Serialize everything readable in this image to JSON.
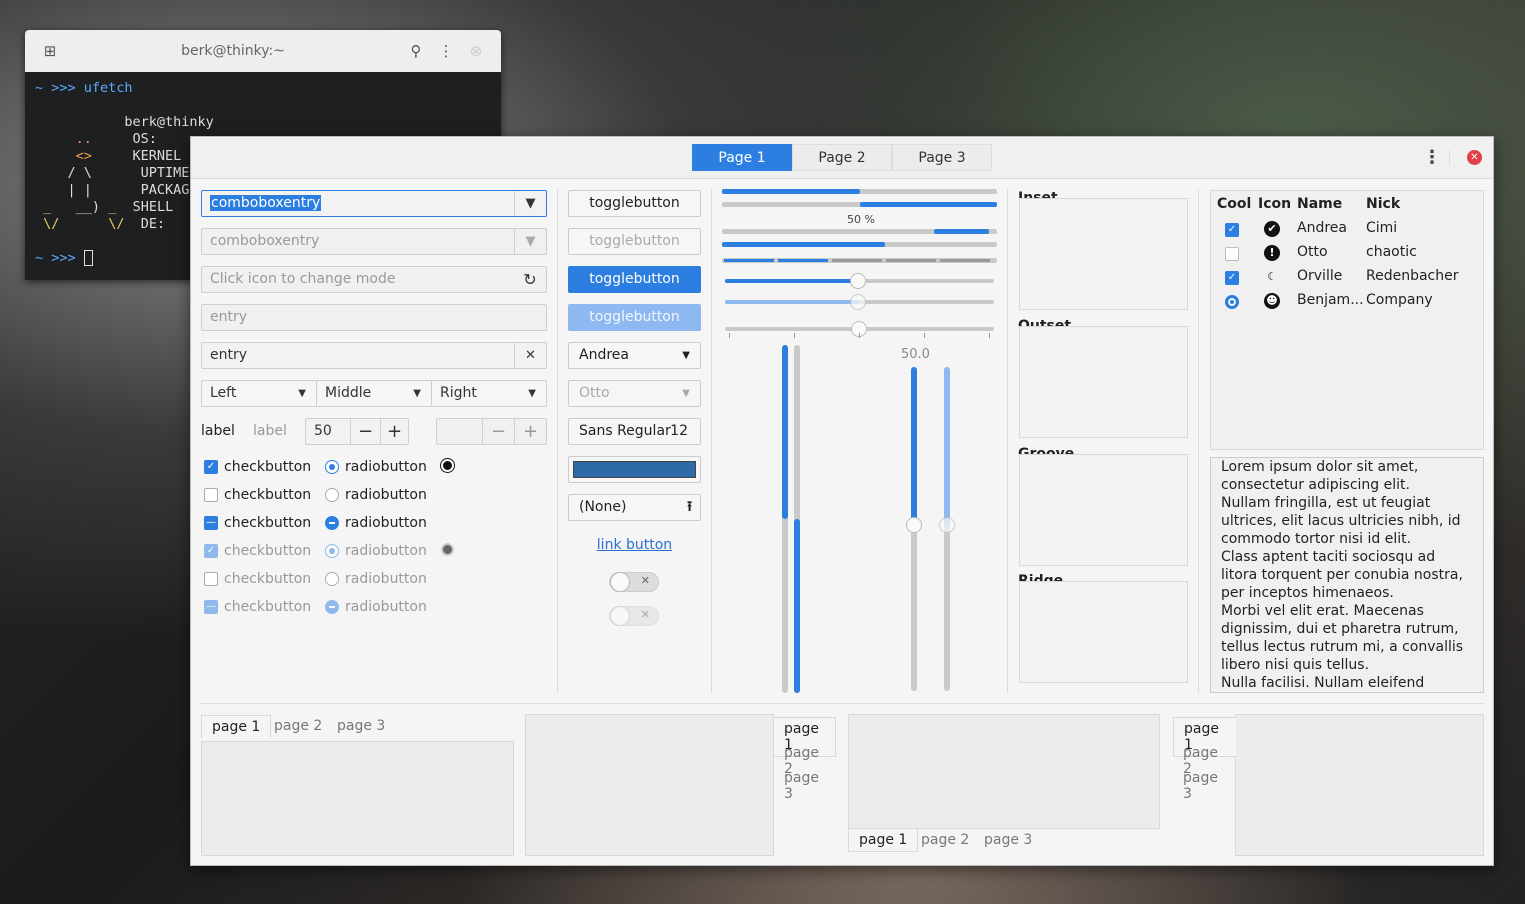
{
  "terminal": {
    "title": "berk@thinky:~",
    "prompt1": "~ >>> ufetch",
    "host": "berk@thinky",
    "os": "OS:",
    "kernel": "KERNEL",
    "uptime": "UPTIME",
    "packages": "PACKAG",
    "shell": "SHELL",
    "de": "DE:",
    "prompt2": "~ >>> "
  },
  "header": {
    "tabs": [
      "Page 1",
      "Page 2",
      "Page 3"
    ]
  },
  "col1": {
    "combo1": "comboboxentry",
    "combo2": "comboboxentry",
    "mode_placeholder": "Click icon to change mode",
    "entry1": "entry",
    "entry2": "entry",
    "seg": [
      "Left",
      "Middle",
      "Right"
    ],
    "label1": "label",
    "label2": "label",
    "spin": "50",
    "checks": [
      {
        "t": "checkbutton",
        "s": "on"
      },
      {
        "t": "checkbutton",
        "s": "off"
      },
      {
        "t": "checkbutton",
        "s": "mix"
      },
      {
        "t": "checkbutton",
        "s": "on"
      },
      {
        "t": "checkbutton",
        "s": "off"
      },
      {
        "t": "checkbutton",
        "s": "mix"
      }
    ],
    "radios": [
      {
        "t": "radiobutton",
        "s": "on"
      },
      {
        "t": "radiobutton",
        "s": "off"
      },
      {
        "t": "radiobutton",
        "s": "mix"
      },
      {
        "t": "radiobutton",
        "s": "on"
      },
      {
        "t": "radiobutton",
        "s": "off"
      },
      {
        "t": "radiobutton",
        "s": "mix"
      }
    ]
  },
  "col2": {
    "toggles": [
      "togglebutton",
      "togglebutton",
      "togglebutton",
      "togglebutton"
    ],
    "combo_andrea": "Andrea",
    "combo_otto": "Otto",
    "font_name": "Sans Regular",
    "font_size": "12",
    "file": "(None)",
    "link": "link button",
    "color": "#2e6aa8"
  },
  "col3": {
    "progress_label": "50 %",
    "scale_value": "50.0",
    "progress": 0.5
  },
  "frames": [
    "Inset",
    "Outset",
    "Groove",
    "Ridge"
  ],
  "tree": {
    "headers": [
      "Cool",
      "Icon",
      "Name",
      "Nick"
    ],
    "rows": [
      {
        "cool": "on",
        "icon": "check-circle-icon",
        "name": "Andrea",
        "nick": "Cimi"
      },
      {
        "cool": "off",
        "icon": "alert-circle-icon",
        "name": "Otto",
        "nick": "chaotic"
      },
      {
        "cool": "on",
        "icon": "moon-icon",
        "name": "Orville",
        "nick": "Redenbacher"
      },
      {
        "cool": "radio",
        "icon": "face-icon",
        "name": "Benjam...",
        "nick": "Company"
      }
    ]
  },
  "text": "Lorem ipsum dolor sit amet, consectetur adipiscing elit.\nNullam fringilla, est ut feugiat ultrices, elit lacus ultricies nibh, id commodo tortor nisi id elit.\nClass aptent taciti sociosqu ad litora torquent per conubia nostra, per inceptos himenaeos.\nMorbi vel elit erat. Maecenas dignissim, dui et pharetra rutrum, tellus lectus rutrum mi, a convallis libero nisi quis tellus.\nNulla facilisi. Nullam eleifend lobortis",
  "notebooks": {
    "tabs": [
      "page 1",
      "page 2",
      "page 3"
    ]
  }
}
